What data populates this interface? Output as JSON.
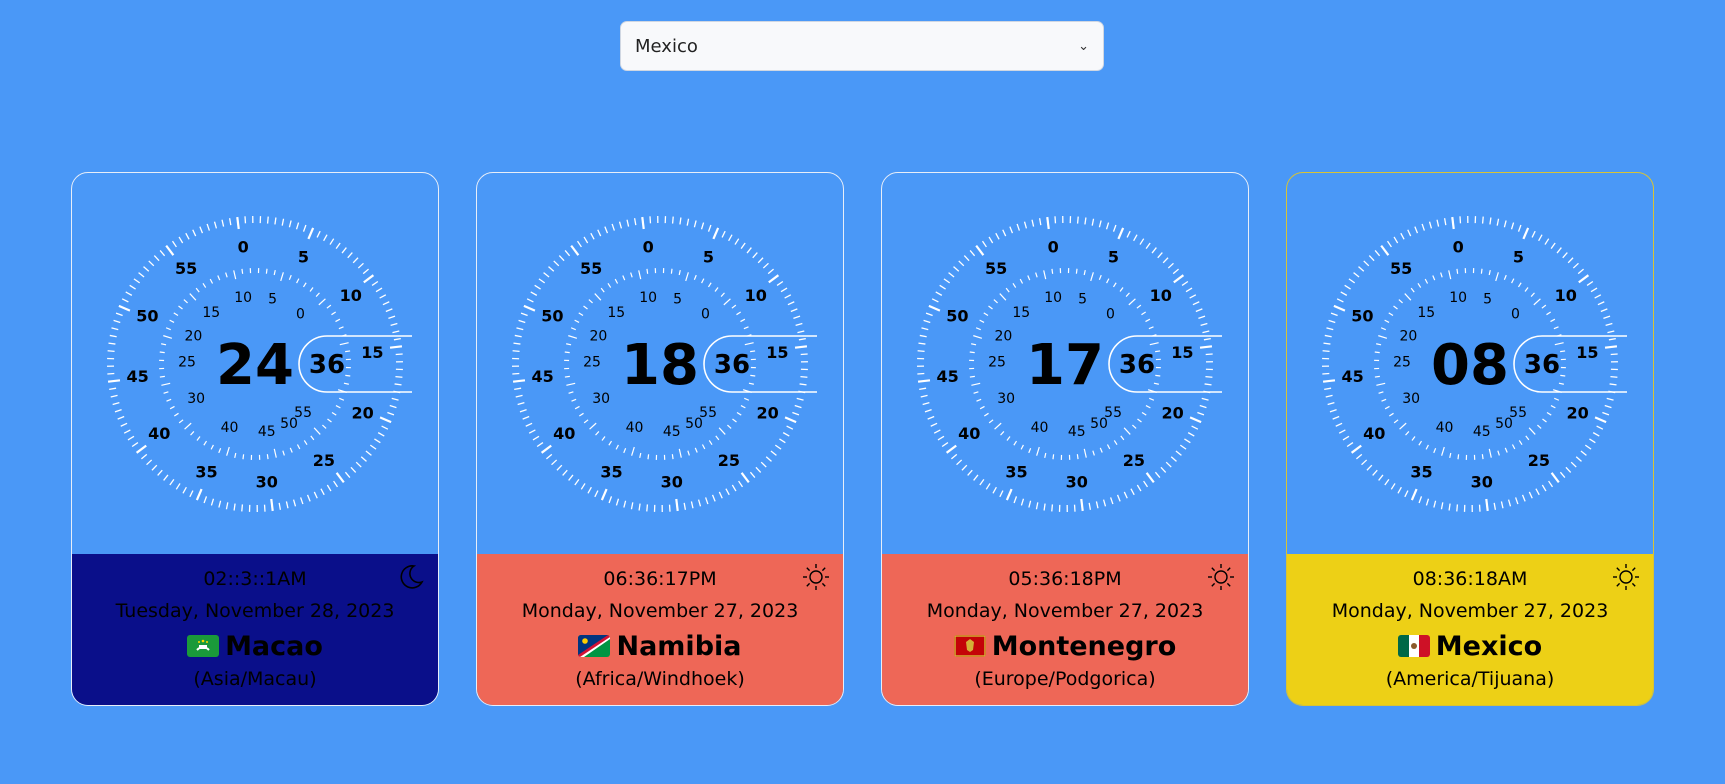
{
  "country_select": {
    "value": "Mexico",
    "chevron_icon": "chevron-down-icon"
  },
  "dial": {
    "outer_numbers": [
      "0",
      "5",
      "10",
      "15",
      "20",
      "25",
      "30",
      "35",
      "40",
      "45",
      "50",
      "55"
    ],
    "inner_numbers": [
      "55",
      "50",
      "45",
      "40",
      "30",
      "25",
      "20",
      "15",
      "10",
      "5",
      "0"
    ]
  },
  "clocks": [
    {
      "hour": "24",
      "minute": "36",
      "time": "02::3::1AM",
      "date": "Tuesday, November 28, 2023",
      "country": "Macao",
      "zone": "(Asia/Macau)",
      "day_icon": "moon-icon",
      "flag_icon": "macao-flag-icon",
      "panel_color": "#0a0f8a",
      "text_color": "#000000"
    },
    {
      "hour": "18",
      "minute": "36",
      "time": "06:36:17PM",
      "date": "Monday, November 27, 2023",
      "country": "Namibia",
      "zone": "(Africa/Windhoek)",
      "day_icon": "sun-icon",
      "flag_icon": "namibia-flag-icon",
      "panel_color": "#ee6757",
      "text_color": "#000000"
    },
    {
      "hour": "17",
      "minute": "36",
      "time": "05:36:18PM",
      "date": "Monday, November 27, 2023",
      "country": "Montenegro",
      "zone": "(Europe/Podgorica)",
      "day_icon": "sun-icon",
      "flag_icon": "montenegro-flag-icon",
      "panel_color": "#ee6757",
      "text_color": "#000000"
    },
    {
      "hour": "08",
      "minute": "36",
      "time": "08:36:18AM",
      "date": "Monday, November 27, 2023",
      "country": "Mexico",
      "zone": "(America/Tijuana)",
      "day_icon": "sun-icon",
      "flag_icon": "mexico-flag-icon",
      "panel_color": "#edd016",
      "text_color": "#000000"
    }
  ],
  "colors": {
    "background": "#4a98f7",
    "tick": "#ffffff"
  }
}
